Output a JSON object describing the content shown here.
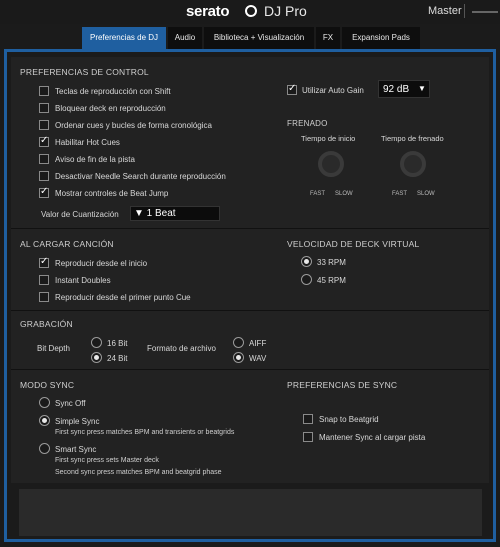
{
  "header": {
    "logo_text": "serato",
    "logo_suffix": "DJ Pro",
    "master_label": "Master"
  },
  "tabs": [
    {
      "label": "Preferencias de DJ",
      "active": true
    },
    {
      "label": "Audio",
      "active": false
    },
    {
      "label": "Biblioteca + Visualización",
      "active": false
    },
    {
      "label": "FX",
      "active": false
    },
    {
      "label": "Expansion Pads",
      "active": false
    }
  ],
  "control": {
    "title": "PREFERENCIAS DE CONTROL",
    "options": [
      {
        "label": "Teclas de reproducción con Shift",
        "checked": false
      },
      {
        "label": "Bloquear deck en reproducción",
        "checked": false
      },
      {
        "label": "Ordenar cues y bucles de forma cronológica",
        "checked": false
      },
      {
        "label": "Habilitar Hot Cues",
        "checked": true
      },
      {
        "label": "Aviso de fin de la pista",
        "checked": false
      },
      {
        "label": "Desactivar Needle Search durante reproducción",
        "checked": false
      },
      {
        "label": "Mostrar controles de Beat Jump",
        "checked": true
      }
    ],
    "quantize_label": "Valor de Cuantización",
    "quantize_value": "▼ 1 Beat",
    "auto_gain_label": "Utilizar Auto Gain",
    "auto_gain_checked": true,
    "auto_gain_value": "92 dB",
    "auto_gain_arrow": "▼"
  },
  "braking": {
    "title": "FRENADO",
    "start_label": "Tiempo de inicio",
    "stop_label": "Tiempo de frenado",
    "fast": "FAST",
    "slow": "SLOW"
  },
  "load": {
    "title": "AL CARGAR CANCIÓN",
    "options": [
      {
        "label": "Reproducir desde el inicio",
        "checked": true
      },
      {
        "label": "Instant Doubles",
        "checked": false
      },
      {
        "label": "Reproducir desde el primer punto Cue",
        "checked": false
      }
    ]
  },
  "deck_speed": {
    "title": "VELOCIDAD DE DECK VIRTUAL",
    "options": [
      {
        "label": "33 RPM",
        "selected": true
      },
      {
        "label": "45 RPM",
        "selected": false
      }
    ]
  },
  "recording": {
    "title": "GRABACIÓN",
    "bit_depth_label": "Bit Depth",
    "bit_options": [
      {
        "label": "16 Bit",
        "selected": false
      },
      {
        "label": "24 Bit",
        "selected": true
      }
    ],
    "format_label": "Formato de archivo",
    "format_options": [
      {
        "label": "AIFF",
        "selected": false
      },
      {
        "label": "WAV",
        "selected": true
      }
    ]
  },
  "sync": {
    "title": "MODO SYNC",
    "options": [
      {
        "label": "Sync Off",
        "selected": false,
        "desc": []
      },
      {
        "label": "Simple Sync",
        "selected": true,
        "desc": [
          "First sync press matches BPM and transients or beatgrids"
        ]
      },
      {
        "label": "Smart Sync",
        "selected": false,
        "desc": [
          "First sync press sets Master deck",
          "Second sync press matches BPM and beatgrid phase"
        ]
      }
    ]
  },
  "sync_prefs": {
    "title": "PREFERENCIAS DE SYNC",
    "options": [
      {
        "label": "Snap to Beatgrid",
        "checked": false
      },
      {
        "label": "Mantener Sync al cargar pista",
        "checked": false
      }
    ]
  },
  "colors": {
    "accent": "#1f5fa0",
    "background": "#1b1b1b",
    "panel": "#222222"
  }
}
